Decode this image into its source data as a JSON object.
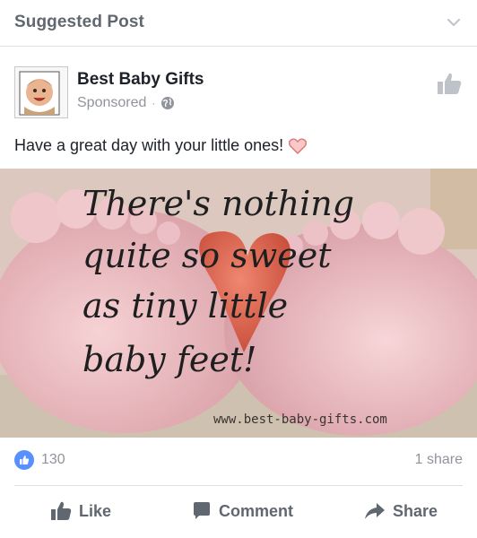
{
  "header": {
    "title": "Suggested Post",
    "menu_icon": "chevron-down-icon"
  },
  "post": {
    "page_name": "Best Baby Gifts",
    "sponsored_label": "Sponsored",
    "separator": "·",
    "audience_icon": "globe-icon",
    "caption": "Have a great day with your little ones!",
    "caption_emoji": "heart-icon",
    "avatar_text": "Best Baby Gifts",
    "image": {
      "lines": [
        "There's nothing",
        "quite so sweet",
        "as tiny little",
        "baby feet!"
      ],
      "watermark": "www.best-baby-gifts.com"
    }
  },
  "stats": {
    "likes": "130",
    "shares": "1 share"
  },
  "actions": {
    "like": "Like",
    "comment": "Comment",
    "share": "Share"
  },
  "colors": {
    "accent": "#5890ff",
    "muted": "#616770",
    "meta": "#90949c",
    "heart": "#f4a6a6"
  }
}
